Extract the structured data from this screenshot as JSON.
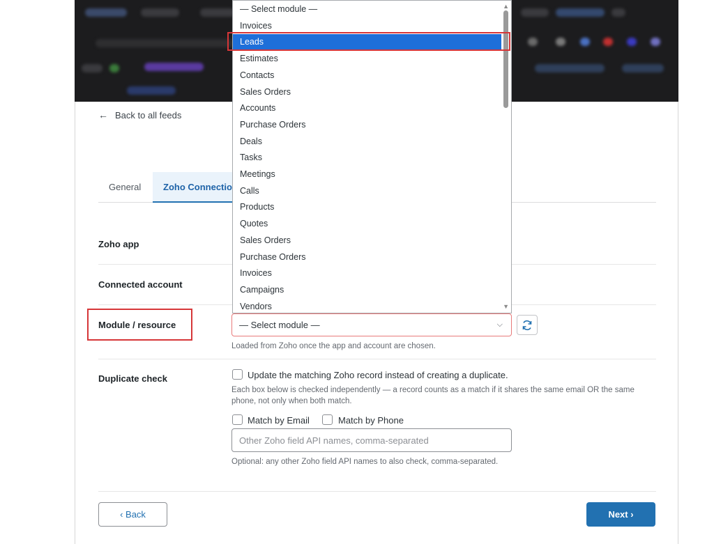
{
  "page": {
    "back_link": "Back to all feeds",
    "tabs": [
      {
        "label": "General"
      },
      {
        "label": "Zoho Connection"
      }
    ]
  },
  "fields": {
    "zoho_app": {
      "label": "Zoho app"
    },
    "connected_account": {
      "label": "Connected account"
    },
    "module": {
      "label": "Module / resource",
      "value": "— Select module —",
      "help": "Loaded from Zoho once the app and account are chosen."
    },
    "duplicate": {
      "label": "Duplicate check",
      "update_label": "Update the matching Zoho record instead of creating a duplicate.",
      "help": "Each box below is checked independently — a record counts as a match if it shares the same email OR the same phone, not only when both match.",
      "match_email": "Match by Email",
      "match_phone": "Match by Phone",
      "other_placeholder": "Other Zoho field API names, comma-separated",
      "other_help": "Optional: any other Zoho field API names to also check, comma-separated."
    }
  },
  "buttons": {
    "back": "‹ Back",
    "next": "Next ›"
  },
  "dropdown": {
    "options": [
      "— Select module —",
      "Invoices",
      "Leads",
      "Estimates",
      "Contacts",
      "Sales Orders",
      "Accounts",
      "Purchase Orders",
      "Deals",
      "Tasks",
      "Meetings",
      "Calls",
      "Products",
      "Quotes",
      "Sales Orders",
      "Purchase Orders",
      "Invoices",
      "Campaigns",
      "Vendors"
    ],
    "selected_index": 2
  },
  "colors": {
    "accent": "#2271b1",
    "highlight_red": "#d63638",
    "selected_option": "#1e6fd9"
  },
  "icons": {
    "back": "arrow-left-icon",
    "select": "chevron-down-icon",
    "refresh": "refresh-icon"
  }
}
